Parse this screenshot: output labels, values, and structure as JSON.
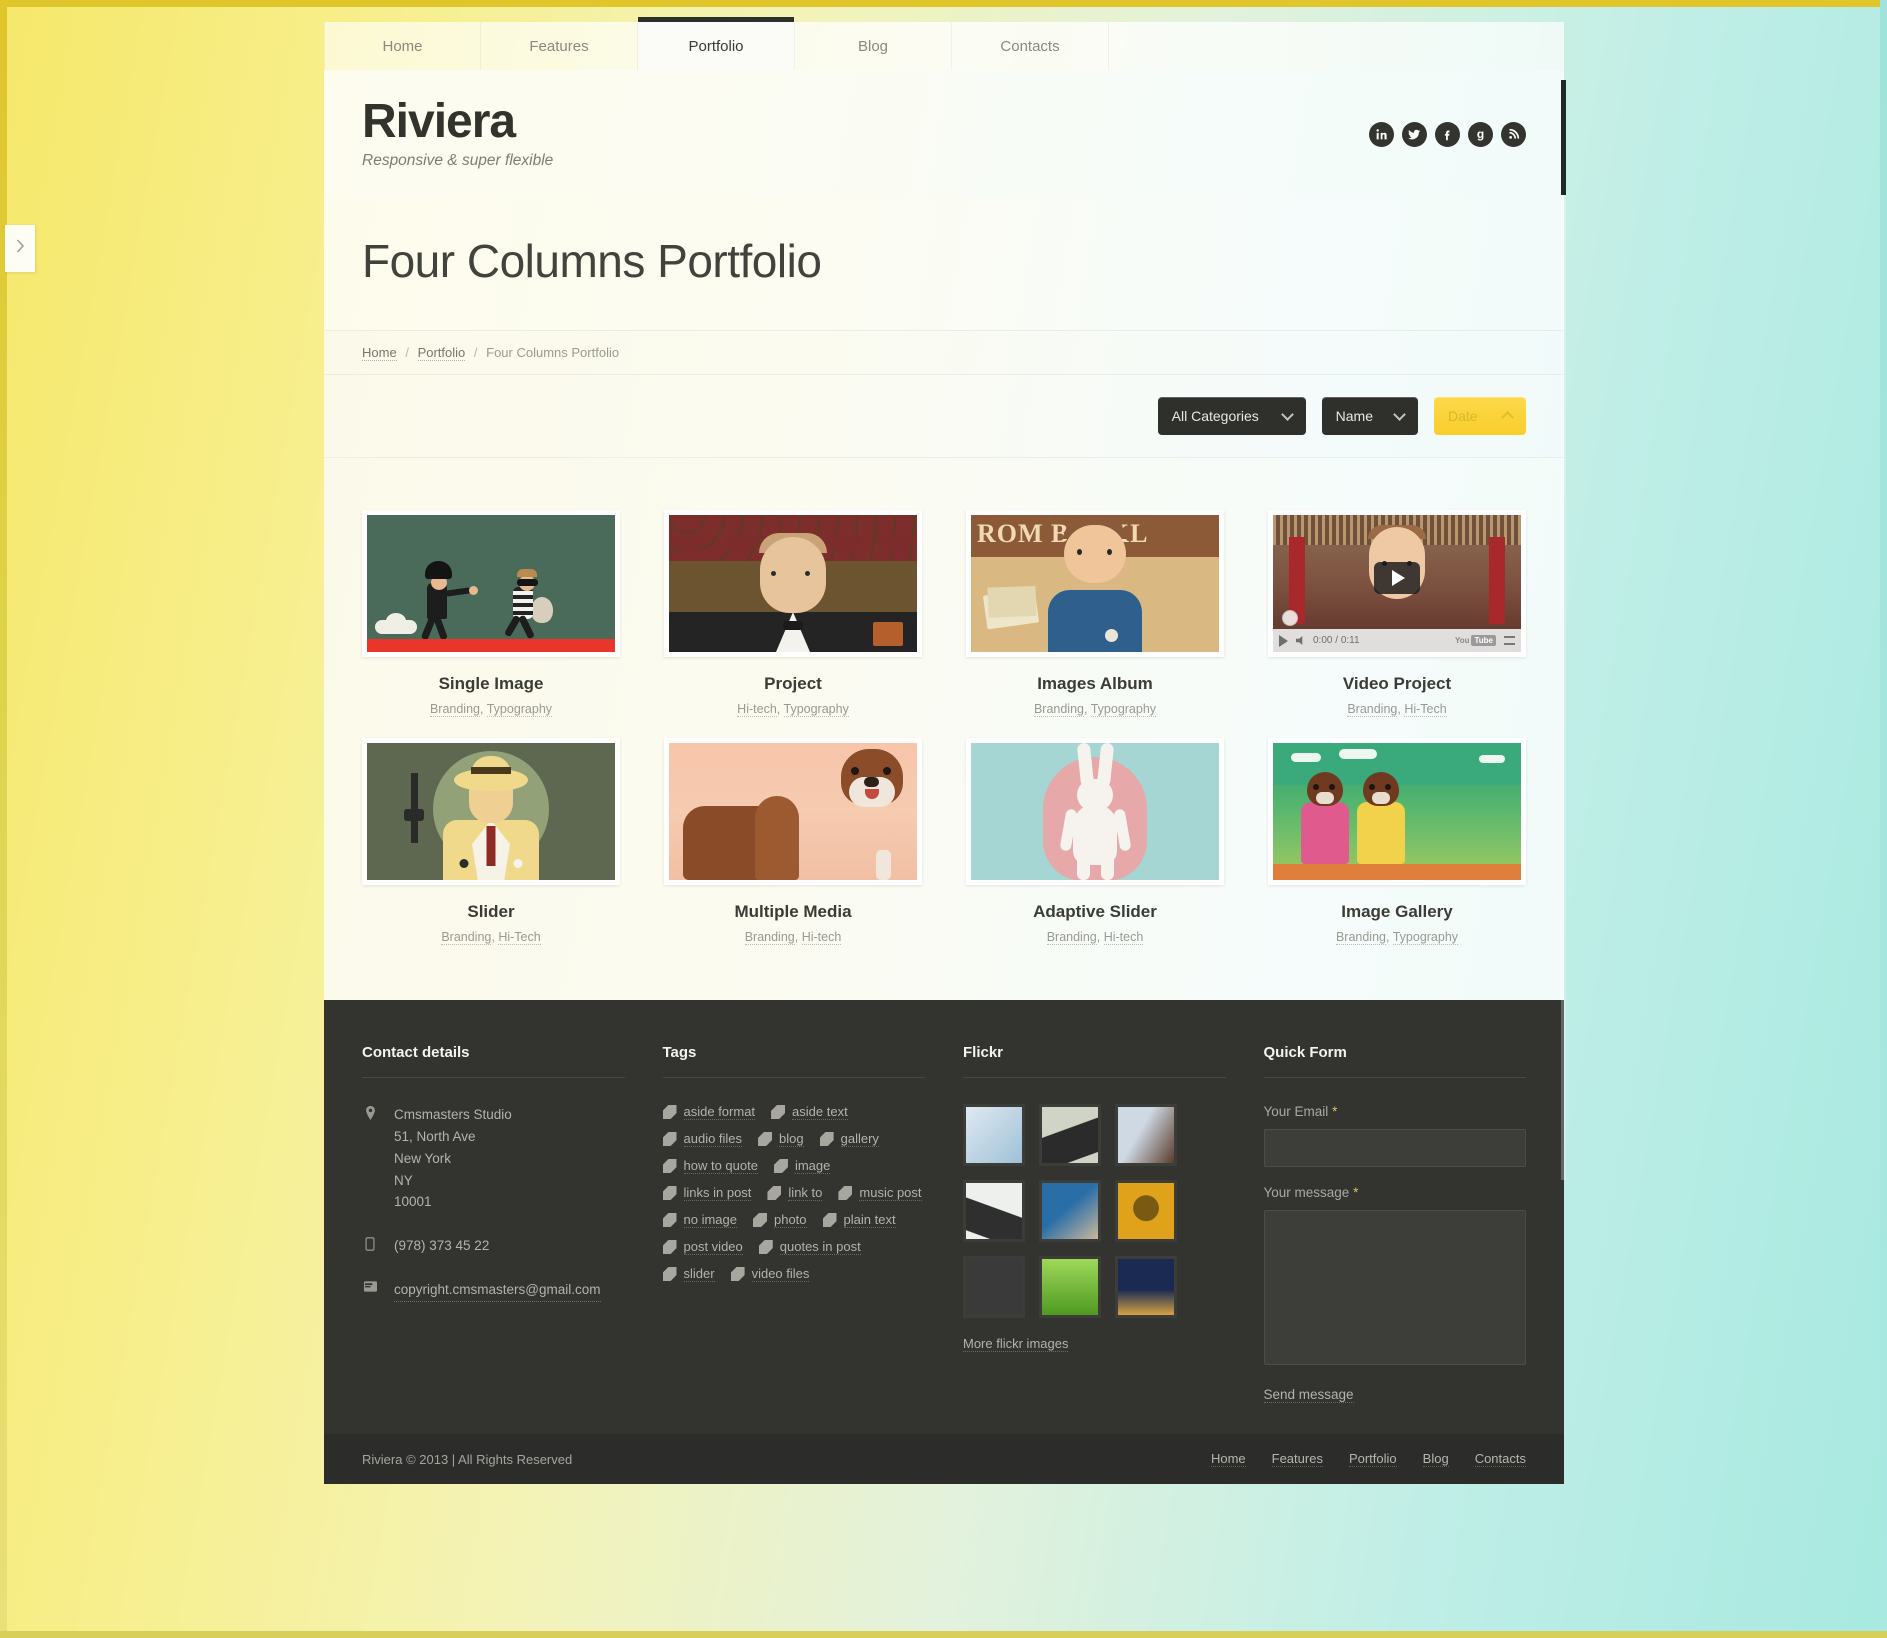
{
  "nav": {
    "items": [
      {
        "label": "Home",
        "active": false
      },
      {
        "label": "Features",
        "active": false
      },
      {
        "label": "Portfolio",
        "active": true
      },
      {
        "label": "Blog",
        "active": false
      },
      {
        "label": "Contacts",
        "active": false
      }
    ]
  },
  "header": {
    "logo_title": "Riviera",
    "logo_subtitle": "Responsive & super flexible",
    "socials": [
      {
        "name": "linkedin-icon",
        "glyph": "in"
      },
      {
        "name": "twitter-icon",
        "glyph": "t"
      },
      {
        "name": "facebook-icon",
        "glyph": "f"
      },
      {
        "name": "google-plus-icon",
        "glyph": "g"
      },
      {
        "name": "rss-icon",
        "glyph": "r"
      }
    ]
  },
  "page": {
    "title": "Four Columns Portfolio",
    "breadcrumbs": [
      {
        "label": "Home",
        "link": true
      },
      {
        "label": "Portfolio",
        "link": true
      },
      {
        "label": "Four Columns Portfolio",
        "link": false
      }
    ]
  },
  "filters": {
    "category": {
      "label": "All Categories",
      "icon": "chevron-down-icon"
    },
    "sort_name": {
      "label": "Name",
      "icon": "chevron-down-icon"
    },
    "sort_date": {
      "label": "Date",
      "icon": "chevron-up-icon",
      "active": true,
      "color": "#f8ce2b"
    }
  },
  "portfolio": {
    "items": [
      {
        "title": "Single Image",
        "categories": [
          "Branding",
          "Typography"
        ],
        "art": "a1"
      },
      {
        "title": "Project",
        "categories": [
          "Hi-tech",
          "Typography"
        ],
        "art": "a2"
      },
      {
        "title": "Images Album",
        "categories": [
          "Branding",
          "Typography"
        ],
        "art": "a3",
        "overlay_text": "ROM BURKL"
      },
      {
        "title": "Video Project",
        "categories": [
          "Branding",
          "Hi-Tech"
        ],
        "art": "a4",
        "video": {
          "current_time": "0:00",
          "duration": "0:11",
          "brand": "YouTube",
          "play_icon": "play-icon"
        }
      },
      {
        "title": "Slider",
        "categories": [
          "Branding",
          "Hi-Tech"
        ],
        "art": "a5",
        "slider_dots": 4,
        "slider_active": 0
      },
      {
        "title": "Multiple Media",
        "categories": [
          "Branding",
          "Hi-tech"
        ],
        "art": "a6"
      },
      {
        "title": "Adaptive Slider",
        "categories": [
          "Branding",
          "Hi-tech"
        ],
        "art": "a7"
      },
      {
        "title": "Image Gallery",
        "categories": [
          "Branding",
          "Typography"
        ],
        "art": "a8"
      }
    ]
  },
  "footer": {
    "contact": {
      "heading": "Contact details",
      "address_icon": "map-pin-icon",
      "address": "Cmsmasters Studio\n51, North Ave\nNew York\nNY\n10001",
      "phone_icon": "mobile-icon",
      "phone": "(978) 373 45 22",
      "email_icon": "envelope-icon",
      "email": "copyright.cmsmasters@gmail.com"
    },
    "tags": {
      "heading": "Tags",
      "items": [
        "aside format",
        "aside text",
        "audio files",
        "blog",
        "gallery",
        "how to quote",
        "image",
        "links in post",
        "link to",
        "music post",
        "no image",
        "photo",
        "plain text",
        "post video",
        "quotes in post",
        "slider",
        "video files"
      ]
    },
    "flickr": {
      "heading": "Flickr",
      "more_label": "More flickr images",
      "thumbs": [
        {
          "name": "tablet-chart-photo",
          "c1": "#dfe9f1",
          "c2": "#9fc0d8"
        },
        {
          "name": "typewriter-photo",
          "c1": "#cfd4c6",
          "c2": "#2b2b2b"
        },
        {
          "name": "portrait-photo",
          "c1": "#cfd9e4",
          "c2": "#5a3c2c"
        },
        {
          "name": "typewriter-white-photo",
          "c1": "#eef0ee",
          "c2": "#2f2f2f"
        },
        {
          "name": "tablet-hands-photo",
          "c1": "#2a6ea8",
          "c2": "#cbb79c"
        },
        {
          "name": "gold-face-photo",
          "c1": "#e0a21b",
          "c2": "#7a5a12"
        },
        {
          "name": "daniel-richards-chalk-photo",
          "c1": "#3a3a3a",
          "c2": "#c9c9c9"
        },
        {
          "name": "grass-photo",
          "c1": "#6fbd2e",
          "c2": "#9ed85a"
        },
        {
          "name": "night-bridge-photo",
          "c1": "#1b2a52",
          "c2": "#d6a244"
        }
      ]
    },
    "form": {
      "heading": "Quick Form",
      "email_label": "Your Email",
      "email_required": "*",
      "email_value": "",
      "message_label": "Your message",
      "message_required": "*",
      "message_value": "",
      "submit_label": "Send message"
    },
    "bottom": {
      "copyright": "Riviera © 2013 | All Rights Reserved",
      "links": [
        "Home",
        "Features",
        "Portfolio",
        "Blog",
        "Contacts"
      ]
    }
  },
  "chrome": {
    "side_tab_icon": "chevron-right-icon",
    "watermark": ""
  }
}
